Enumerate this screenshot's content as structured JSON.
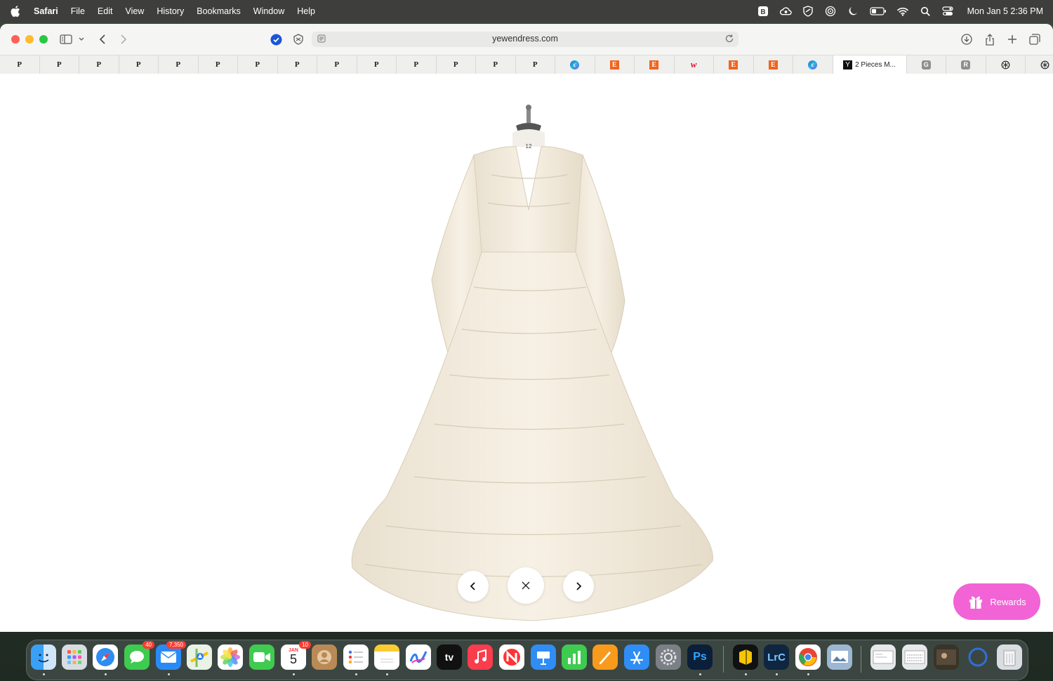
{
  "menubar": {
    "app_name": "Safari",
    "menus": [
      "File",
      "Edit",
      "View",
      "History",
      "Bookmarks",
      "Window",
      "Help"
    ],
    "clock": "Mon Jan 5  2:36 PM"
  },
  "toolbar": {
    "url": "yewendress.com"
  },
  "bookmarks": [
    {
      "label": "P"
    },
    {
      "label": "P"
    },
    {
      "label": "P"
    },
    {
      "label": "P"
    },
    {
      "label": "P"
    },
    {
      "label": "P"
    },
    {
      "label": "P"
    },
    {
      "label": "P"
    },
    {
      "label": "P"
    },
    {
      "label": "P"
    },
    {
      "label": "P"
    },
    {
      "label": "P"
    },
    {
      "label": "P"
    },
    {
      "label": "P"
    }
  ],
  "favicon_tabs": {
    "e": "E",
    "c": "c",
    "w": "w",
    "y": "Y",
    "g": "G",
    "r": "R"
  },
  "active_tab": {
    "label": "2 Pieces M..."
  },
  "viewer": {
    "mannequin_size": "12"
  },
  "rewards": {
    "label": "Rewards",
    "color": "#f263d6"
  },
  "dock": {
    "messages_badge": "40",
    "mail_badge": "7,350",
    "calendar_month": "JAN",
    "calendar_day": "5",
    "calendar_badge": "10",
    "tv_label": "tv",
    "ps_label": "Ps",
    "lrc_label": "LrC"
  }
}
